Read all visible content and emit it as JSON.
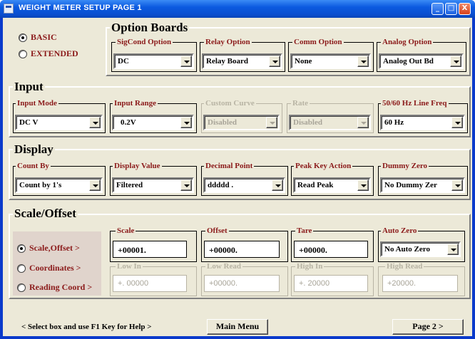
{
  "window": {
    "title": "WEIGHT METER SETUP  PAGE  1",
    "buttons": [
      "_",
      "□",
      "X"
    ]
  },
  "mode": {
    "options": [
      {
        "label": "BASIC",
        "selected": true
      },
      {
        "label": "EXTENDED",
        "selected": false
      }
    ]
  },
  "option_boards": {
    "title": "Option Boards",
    "fields": [
      {
        "label": "SigCond Option",
        "value": "DC"
      },
      {
        "label": "Relay Option",
        "value": "Relay Board"
      },
      {
        "label": "Comm Option",
        "value": "None"
      },
      {
        "label": "Analog Option",
        "value": "Analog Out Bd"
      }
    ]
  },
  "input": {
    "title": "Input",
    "fields": [
      {
        "label": "Input Mode",
        "value": "DC V",
        "enabled": true
      },
      {
        "label": "Input Range",
        "value": "0.2V",
        "enabled": true
      },
      {
        "label": "Custom Curve",
        "value": "Disabled",
        "enabled": false
      },
      {
        "label": "Rate",
        "value": "Disabled",
        "enabled": false
      },
      {
        "label": "50/60 Hz Line Freq",
        "value": "60 Hz",
        "enabled": true
      }
    ]
  },
  "display": {
    "title": "Display",
    "fields": [
      {
        "label": "Count By",
        "value": "Count by 1's"
      },
      {
        "label": "Display Value",
        "value": "Filtered"
      },
      {
        "label": "Decimal Point",
        "value": "ddddd ."
      },
      {
        "label": "Peak Key Action",
        "value": "Read Peak"
      },
      {
        "label": "Dummy Zero",
        "value": "No Dummy Zer"
      }
    ]
  },
  "scale_offset": {
    "title": "Scale/Offset",
    "radios": [
      {
        "label": "Scale,Offset >",
        "selected": true
      },
      {
        "label": "Coordinates  >",
        "selected": false
      },
      {
        "label": "Reading Coord >",
        "selected": false
      }
    ],
    "row1": [
      {
        "label": "Scale",
        "value": "+00001."
      },
      {
        "label": "Offset",
        "value": "+00000."
      },
      {
        "label": "Tare",
        "value": "+00000."
      }
    ],
    "auto_zero": {
      "label": "Auto Zero",
      "value": "No Auto Zero"
    },
    "row2": [
      {
        "label": "Low In",
        "value": "+. 00000"
      },
      {
        "label": "Low Read",
        "value": "+00000."
      },
      {
        "label": "High In",
        "value": "+. 20000"
      },
      {
        "label": "High Read",
        "value": "+20000."
      }
    ]
  },
  "footer": {
    "help": "<  Select box and use F1 Key for Help  >",
    "main_menu": "Main Menu",
    "page2": "Page 2   >"
  }
}
